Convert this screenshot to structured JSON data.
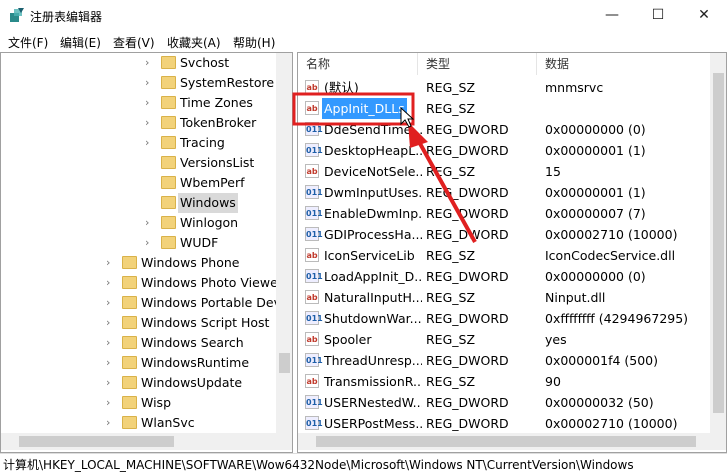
{
  "window": {
    "title": "注册表编辑器",
    "minimize": "—",
    "maximize": "☐",
    "close": "✕"
  },
  "menu": [
    "文件(F)",
    "编辑(E)",
    "查看(V)",
    "收藏夹(A)",
    "帮助(H)"
  ],
  "tree": [
    {
      "label": "Svchost",
      "level": 2,
      "expand": true
    },
    {
      "label": "SystemRestore",
      "level": 2,
      "expand": true
    },
    {
      "label": "Time Zones",
      "level": 2,
      "expand": true
    },
    {
      "label": "TokenBroker",
      "level": 2,
      "expand": true
    },
    {
      "label": "Tracing",
      "level": 2,
      "expand": true
    },
    {
      "label": "VersionsList",
      "level": 2,
      "expand": false
    },
    {
      "label": "WbemPerf",
      "level": 2,
      "expand": false
    },
    {
      "label": "Windows",
      "level": 2,
      "expand": false,
      "selected": true
    },
    {
      "label": "Winlogon",
      "level": 2,
      "expand": true
    },
    {
      "label": "WUDF",
      "level": 2,
      "expand": true
    },
    {
      "label": "Windows Phone",
      "level": 1,
      "expand": true
    },
    {
      "label": "Windows Photo Viewer",
      "level": 1,
      "expand": true
    },
    {
      "label": "Windows Portable Dev",
      "level": 1,
      "expand": true
    },
    {
      "label": "Windows Script Host",
      "level": 1,
      "expand": true
    },
    {
      "label": "Windows Search",
      "level": 1,
      "expand": true
    },
    {
      "label": "WindowsRuntime",
      "level": 1,
      "expand": true
    },
    {
      "label": "WindowsUpdate",
      "level": 1,
      "expand": true
    },
    {
      "label": "Wisp",
      "level": 1,
      "expand": true
    },
    {
      "label": "WlanSvc",
      "level": 1,
      "expand": true
    }
  ],
  "columns": {
    "name": "名称",
    "type": "类型",
    "data": "数据"
  },
  "values": [
    {
      "name": "(默认)",
      "type": "REG_SZ",
      "data": "mnmsrvc",
      "icon": "sz"
    },
    {
      "name": "AppInit_DLLs",
      "type": "REG_SZ",
      "data": "",
      "icon": "sz",
      "selected": true
    },
    {
      "name": "DdeSendTime...",
      "type": "REG_DWORD",
      "data": "0x00000000 (0)",
      "icon": "dw"
    },
    {
      "name": "DesktopHeapL...",
      "type": "REG_DWORD",
      "data": "0x00000001 (1)",
      "icon": "dw"
    },
    {
      "name": "DeviceNotSele...",
      "type": "REG_SZ",
      "data": "15",
      "icon": "sz"
    },
    {
      "name": "DwmInputUses...",
      "type": "REG_DWORD",
      "data": "0x00000001 (1)",
      "icon": "dw"
    },
    {
      "name": "EnableDwmInp...",
      "type": "REG_DWORD",
      "data": "0x00000007 (7)",
      "icon": "dw"
    },
    {
      "name": "GDIProcessHa...",
      "type": "REG_DWORD",
      "data": "0x00002710 (10000)",
      "icon": "dw"
    },
    {
      "name": "IconServiceLib",
      "type": "REG_SZ",
      "data": "IconCodecService.dll",
      "icon": "sz"
    },
    {
      "name": "LoadAppInit_D...",
      "type": "REG_DWORD",
      "data": "0x00000000 (0)",
      "icon": "dw"
    },
    {
      "name": "NaturalInputH...",
      "type": "REG_SZ",
      "data": "Ninput.dll",
      "icon": "sz"
    },
    {
      "name": "ShutdownWar...",
      "type": "REG_DWORD",
      "data": "0xffffffff (4294967295)",
      "icon": "dw"
    },
    {
      "name": "Spooler",
      "type": "REG_SZ",
      "data": "yes",
      "icon": "sz"
    },
    {
      "name": "ThreadUnresp...",
      "type": "REG_DWORD",
      "data": "0x000001f4 (500)",
      "icon": "dw"
    },
    {
      "name": "TransmissionR...",
      "type": "REG_SZ",
      "data": "90",
      "icon": "sz"
    },
    {
      "name": "USERNestedW...",
      "type": "REG_DWORD",
      "data": "0x00000032 (50)",
      "icon": "dw"
    },
    {
      "name": "USERPostMess...",
      "type": "REG_DWORD",
      "data": "0x00002710 (10000)",
      "icon": "dw"
    }
  ],
  "icon_text": {
    "sz": "ab",
    "dw": "011"
  },
  "status": "计算机\\HKEY_LOCAL_MACHINE\\SOFTWARE\\Wow6432Node\\Microsoft\\Windows NT\\CurrentVersion\\Windows",
  "annotation_color": "#e02020"
}
